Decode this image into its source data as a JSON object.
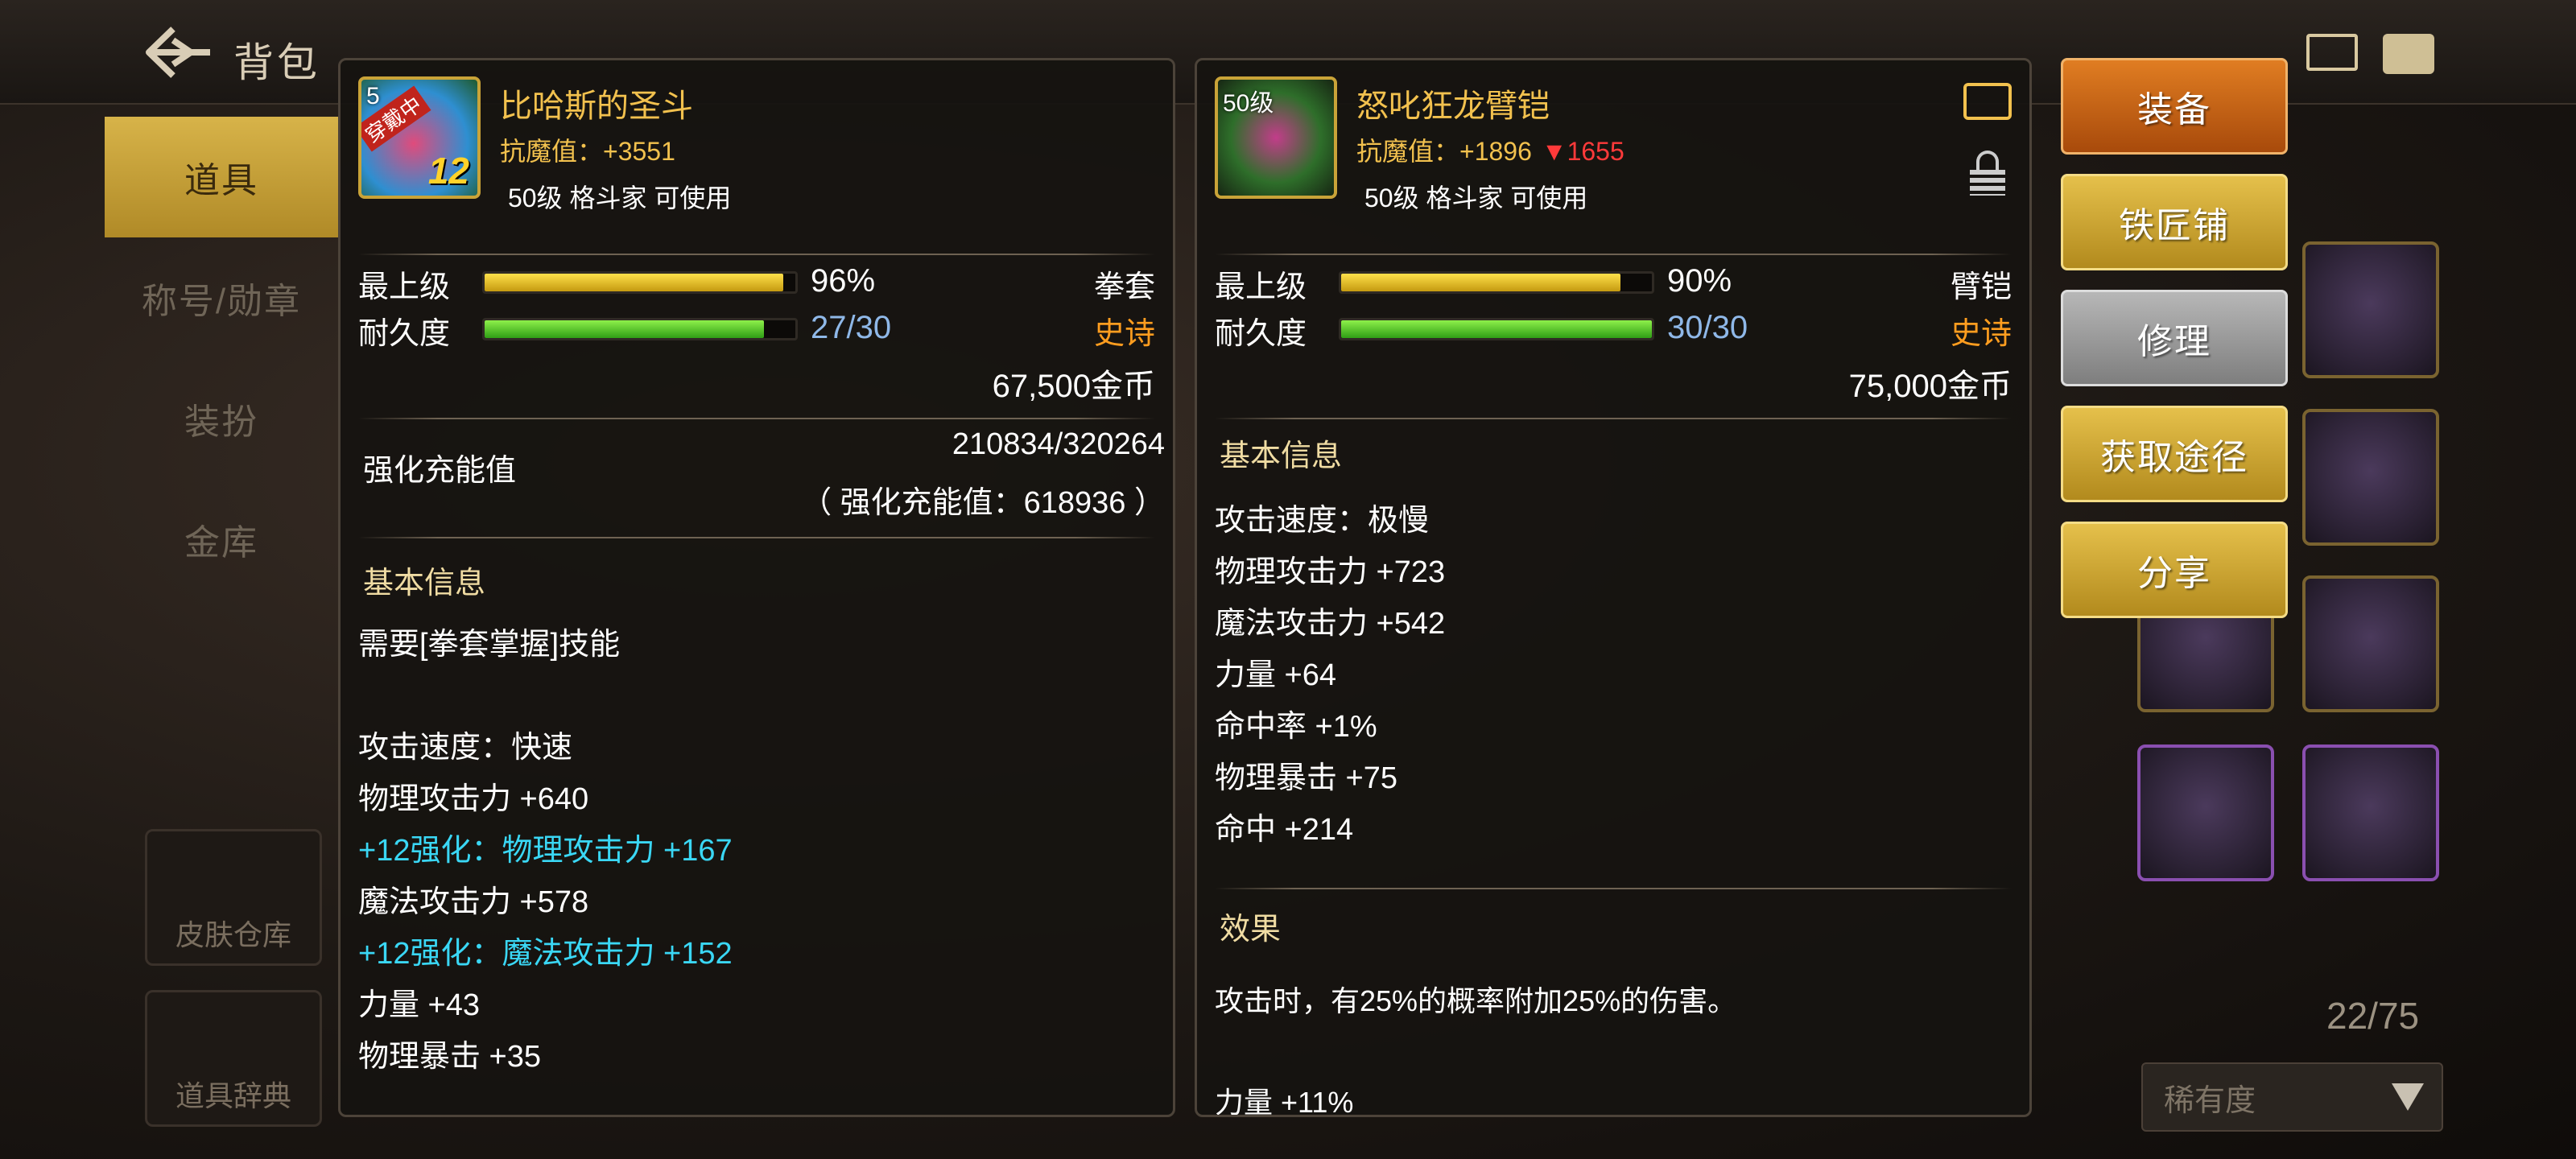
{
  "background": {
    "top_title": "背包",
    "menu": [
      "道具",
      "称号/勋章",
      "装扮",
      "金库"
    ],
    "side_buttons": [
      "皮肤仓库",
      "道具辞典"
    ],
    "count": "22/75",
    "rarity_select": "稀有度"
  },
  "left_item": {
    "level_tag": "5",
    "equipped_tag": "穿戴中",
    "plus_level": "12",
    "name": "比哈斯的圣斗",
    "resist_label": "抗魔值：",
    "resist_value": "+3551",
    "requirement": "50级 格斗家 可使用",
    "grade_label": "最上级",
    "grade_percent": "96%",
    "grade_fill": 0.96,
    "durability_label": "耐久度",
    "durability_value": "27/30",
    "durability_fill": 0.9,
    "type": "拳套",
    "rarity": "史诗",
    "price": "67,500金币",
    "enhance_label": "强化充能值",
    "enhance_value": "210834/320264",
    "enhance_total": "（ 强化充能值：618936 ）",
    "basic_info_title": "基本信息",
    "properties": [
      {
        "text": "需要[拳套掌握]技能",
        "style": "normal"
      },
      {
        "text": "",
        "style": "blank"
      },
      {
        "text": "攻击速度：快速",
        "style": "normal"
      },
      {
        "text": "物理攻击力 +640",
        "style": "normal"
      },
      {
        "text": "+12强化：物理攻击力 +167",
        "style": "cyan"
      },
      {
        "text": "魔法攻击力 +578",
        "style": "normal"
      },
      {
        "text": "+12强化：魔法攻击力 +152",
        "style": "cyan"
      },
      {
        "text": "力量 +43",
        "style": "normal"
      },
      {
        "text": "物理暴击 +35",
        "style": "normal"
      }
    ]
  },
  "right_item": {
    "level_tag": "50级",
    "name": "怒叱狂龙臂铠",
    "resist_label": "抗魔值：",
    "resist_value": "+1896",
    "resist_diff": "▼1655",
    "requirement": "50级 格斗家 可使用",
    "grade_label": "最上级",
    "grade_percent": "90%",
    "grade_fill": 0.9,
    "durability_label": "耐久度",
    "durability_value": "30/30",
    "durability_fill": 1.0,
    "type": "臂铠",
    "rarity": "史诗",
    "price": "75,000金币",
    "basic_info_title": "基本信息",
    "properties": [
      "攻击速度：极慢",
      "物理攻击力 +723",
      "魔法攻击力 +542",
      "力量 +64",
      "命中率 +1%",
      "物理暴击 +75",
      "命中 +214"
    ],
    "effect_title": "效果",
    "effect_text": "攻击时，有25%的概率附加25%的伤害。",
    "cut_line": "力量 +11%"
  },
  "actions": {
    "equip": "装备",
    "blacksmith": "铁匠铺",
    "repair": "修理",
    "obtain": "获取途径",
    "share": "分享"
  }
}
